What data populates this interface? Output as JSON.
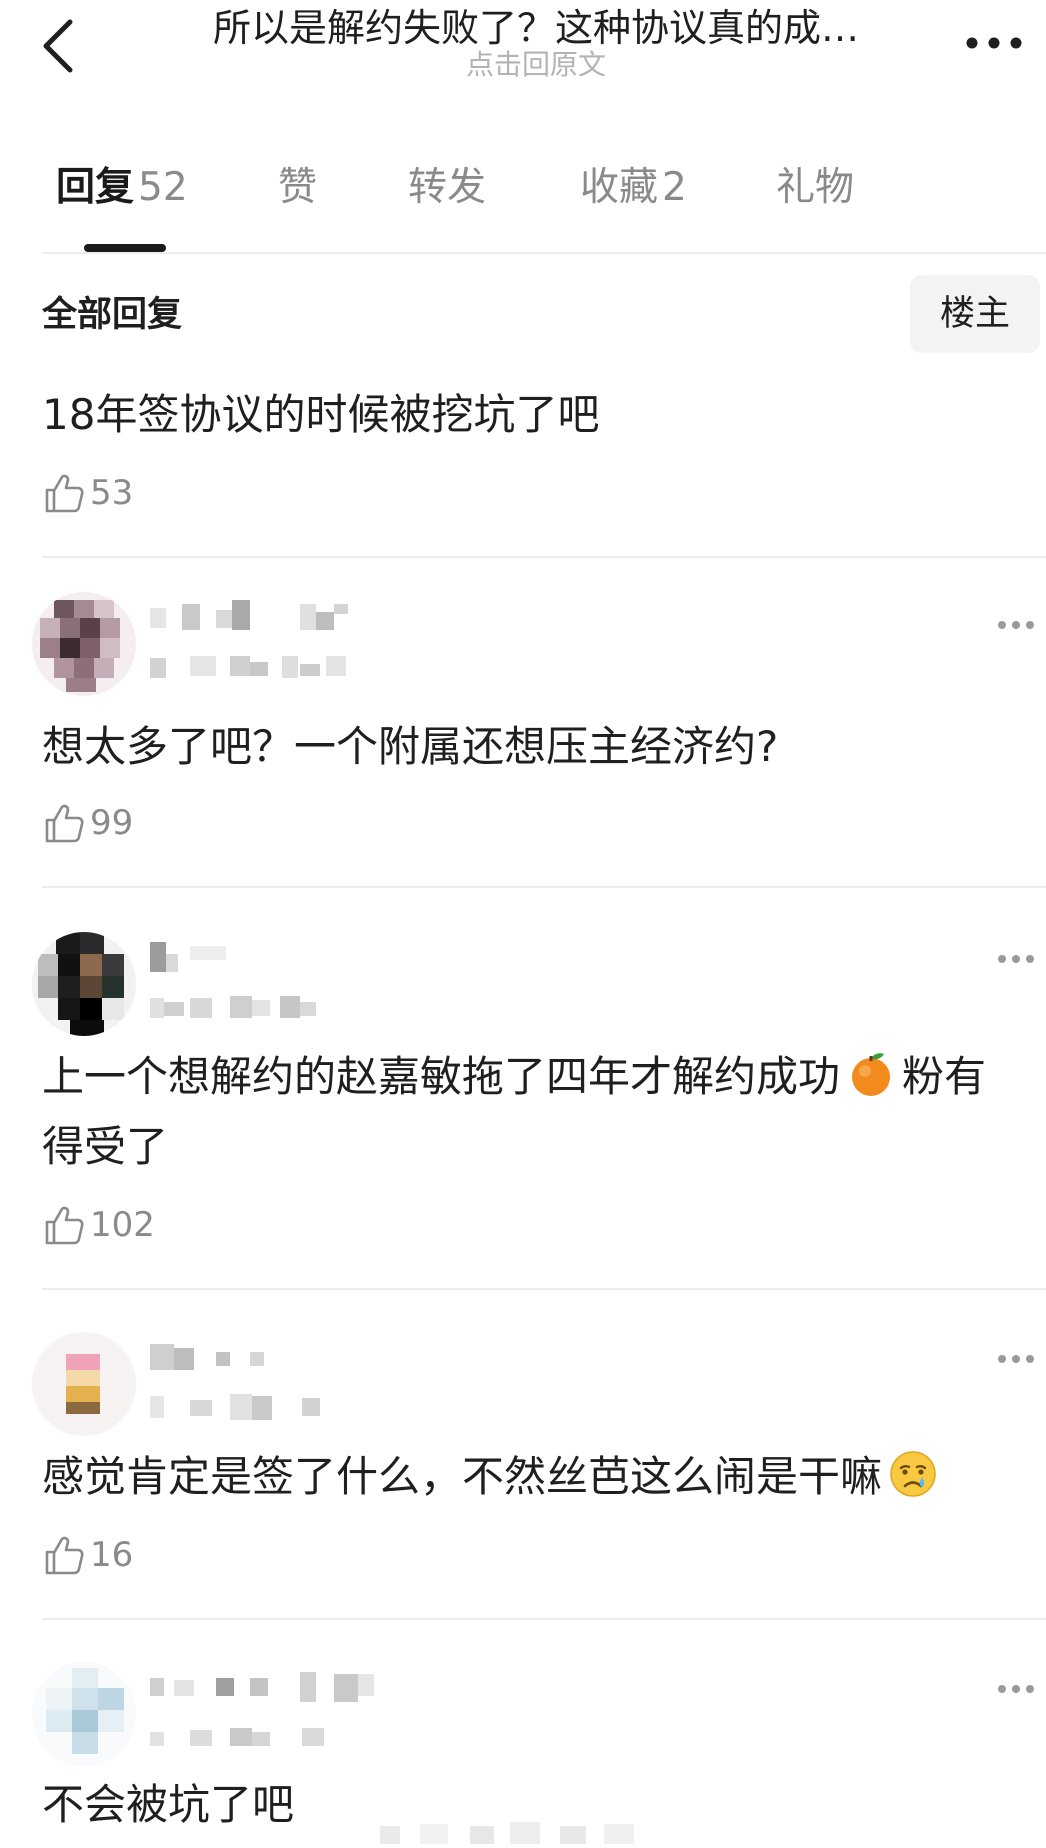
{
  "nav": {
    "title": "所以是解约失败了？这种协议真的成…",
    "subtitle": "点击回原文"
  },
  "tabs": [
    {
      "label": "回复",
      "count": "52",
      "active": true
    },
    {
      "label": "赞",
      "count": "",
      "active": false
    },
    {
      "label": "转发",
      "count": "",
      "active": false
    },
    {
      "label": "收藏",
      "count": "2",
      "active": false
    },
    {
      "label": "礼物",
      "count": "",
      "active": false
    }
  ],
  "filter": {
    "title": "全部回复",
    "op_button": "楼主"
  },
  "comments": [
    {
      "text": "18年签协议的时候被挖坑了吧",
      "likes": "53",
      "has_header": false
    },
    {
      "text": "想太多了吧？一个附属还想压主经济约?",
      "likes": "99",
      "has_header": true,
      "avatar_icon": "pixelated-avatar"
    },
    {
      "text_before_emoji": "上一个想解约的赵嘉敏拖了四年才解约成功",
      "emoji_icon": "orange-emoji-icon",
      "text_after_emoji": "粉有得受了",
      "likes": "102",
      "has_header": true,
      "avatar_icon": "pixelated-avatar"
    },
    {
      "text_before_emoji": "感觉肯定是签了什么，不然丝芭这么闹是干嘛",
      "emoji_icon": "crying-face-emoji-icon",
      "likes": "16",
      "has_header": true,
      "avatar_icon": "pixelated-avatar"
    },
    {
      "text": "不会被坑了吧",
      "has_header": true,
      "avatar_icon": "pixelated-avatar"
    }
  ],
  "icons": {
    "back": "chevron-left-icon",
    "more": "more-dots-icon",
    "like": "thumbs-up-icon",
    "comment_more": "more-dots-icon"
  },
  "colors": {
    "text": "#1f1f1f",
    "muted": "#8a8a8a",
    "subtitle": "#b3b3b3",
    "active_tab_indicator": "#1a1a1a",
    "op_button_bg": "#f3f3f3"
  }
}
